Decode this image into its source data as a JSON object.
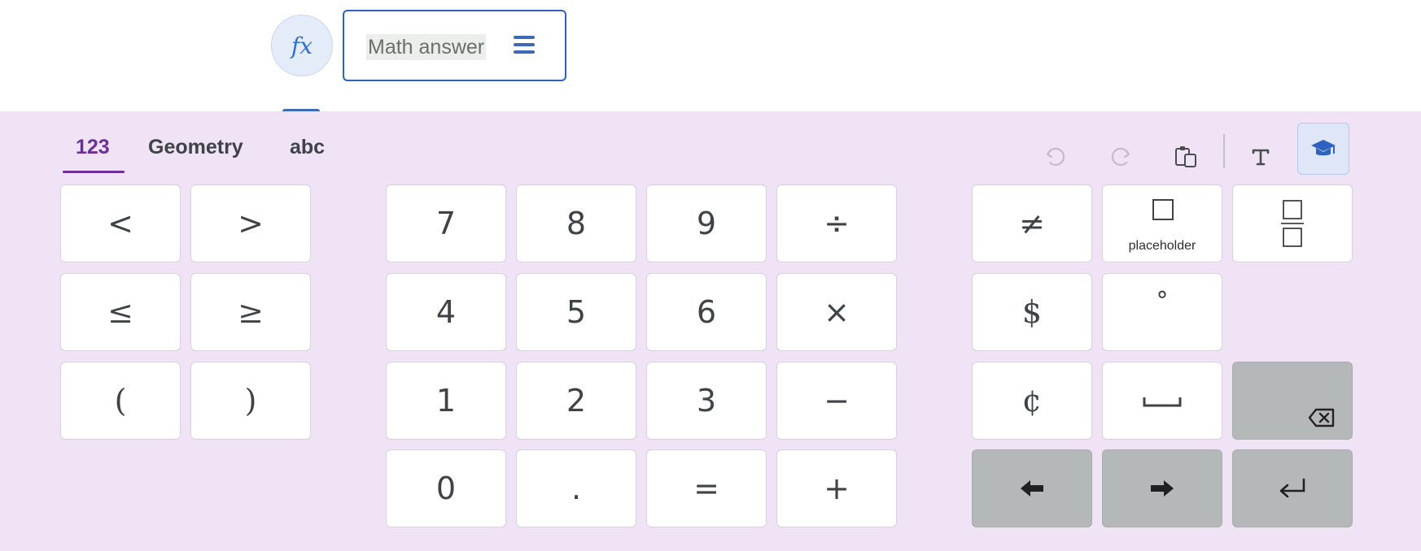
{
  "answer": {
    "fx_label": "fx",
    "placeholder": "Math answer"
  },
  "keyboard": {
    "tabs": [
      {
        "label": "123",
        "active": true
      },
      {
        "label": "Geometry",
        "active": false
      },
      {
        "label": "abc",
        "active": false
      }
    ],
    "tools": [
      "undo-icon",
      "redo-icon",
      "paste-icon",
      "text-icon",
      "graduation-cap-icon"
    ],
    "left_keys": [
      "<",
      ">",
      "≤",
      "≥",
      "(",
      ")"
    ],
    "number_keys": [
      "7",
      "8",
      "9",
      "÷",
      "4",
      "5",
      "6",
      "×",
      "1",
      "2",
      "3",
      "−",
      "0",
      ".",
      "=",
      "+"
    ],
    "right_keys": {
      "not_equal": "≠",
      "placeholder_label": "placeholder",
      "dollar": "$",
      "degree": "°",
      "cent": "¢"
    }
  },
  "colors": {
    "accent_purple": "#6b2f98",
    "accent_blue": "#2e62c0",
    "keyboard_bg": "#efe3f5",
    "gray_key": "#b5b8b9"
  }
}
